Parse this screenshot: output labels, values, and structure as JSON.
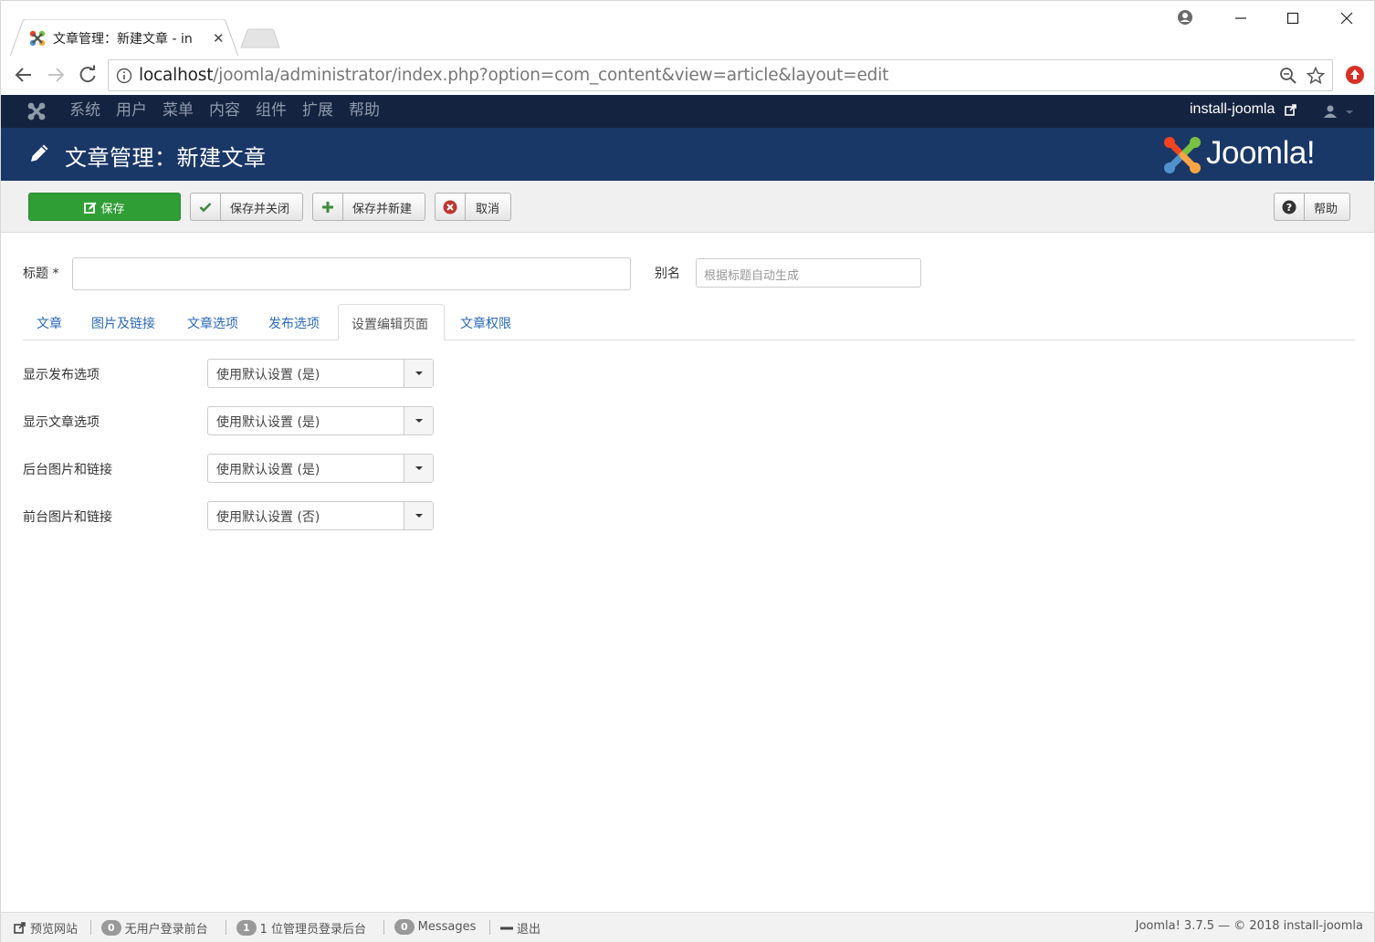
{
  "browser": {
    "tab_title": "文章管理：新建文章 - in",
    "url_host": "localhost",
    "url_path": "/joomla/administrator/index.php?option=com_content&view=article&layout=edit"
  },
  "joomla_nav": {
    "menu": [
      "系统",
      "用户",
      "菜单",
      "内容",
      "组件",
      "扩展",
      "帮助"
    ],
    "site_name": "install-joomla"
  },
  "header": {
    "title": "文章管理：新建文章",
    "brand": "Joomla!"
  },
  "toolbar": {
    "save": "保存",
    "save_close": "保存并关闭",
    "save_new": "保存并新建",
    "cancel": "取消",
    "help": "帮助"
  },
  "form": {
    "title_label": "标题 *",
    "title_value": "",
    "alias_label": "别名",
    "alias_placeholder": "根据标题自动生成"
  },
  "tabs": [
    {
      "label": "文章",
      "active": false
    },
    {
      "label": "图片及链接",
      "active": false
    },
    {
      "label": "文章选项",
      "active": false
    },
    {
      "label": "发布选项",
      "active": false
    },
    {
      "label": "设置编辑页面",
      "active": true
    },
    {
      "label": "文章权限",
      "active": false
    }
  ],
  "settings": [
    {
      "label": "显示发布选项",
      "value": "使用默认设置 (是)"
    },
    {
      "label": "显示文章选项",
      "value": "使用默认设置 (是)"
    },
    {
      "label": "后台图片和链接",
      "value": "使用默认设置 (是)"
    },
    {
      "label": "前台图片和链接",
      "value": "使用默认设置 (否)"
    }
  ],
  "status": {
    "preview": "预览网站",
    "visitors_count": "0",
    "visitors_text": "无用户登录前台",
    "admins_count": "1",
    "admins_text": "1 位管理员登录后台",
    "messages_count": "0",
    "messages_text": "Messages",
    "logout": "退出",
    "copyright": "Joomla! 3.7.5 — © 2018 install-joomla"
  },
  "colors": {
    "nav_bg": "#14233f",
    "header_bg": "#1a3867",
    "save_green": "#2f9e35",
    "link_blue": "#2a69b8"
  }
}
